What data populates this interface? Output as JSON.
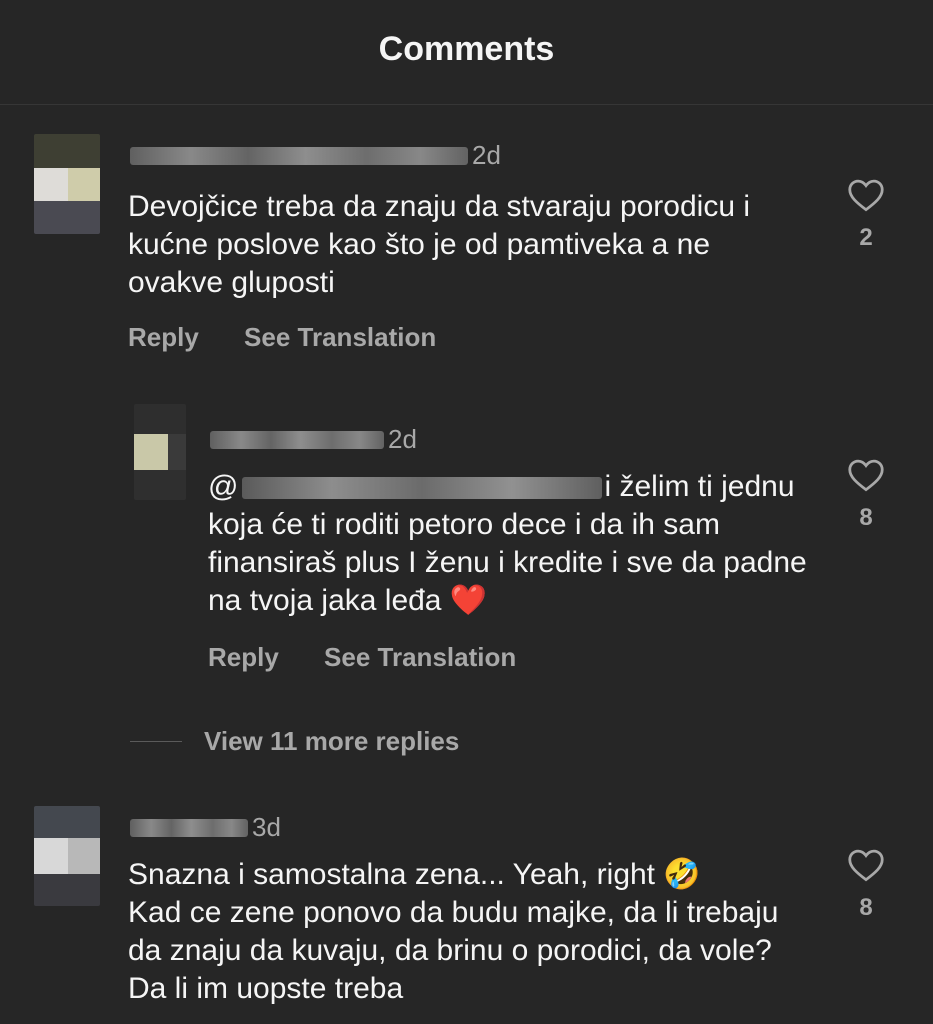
{
  "header": {
    "title": "Comments"
  },
  "comments": [
    {
      "time": "2d",
      "text": "Devojčice treba da znaju da stvaraju porodicu i kućne poslove kao što je od pamtiveka a ne ovakve gluposti",
      "reply_label": "Reply",
      "translate_label": "See Translation",
      "likes": "2"
    },
    {
      "time": "2d",
      "text_prefix": "@",
      "text": "i želim ti jednu koja će ti roditi petoro dece i da ih sam finansiraš plus I ženu i kredite i sve da padne na tvoja jaka leđa",
      "emoji": "❤️",
      "reply_label": "Reply",
      "translate_label": "See Translation",
      "likes": "8"
    },
    {
      "time": "3d",
      "text": "Snazna i samostalna zena... Yeah, right",
      "text_cont": "Kad ce zene ponovo da budu majke, da li trebaju da znaju da kuvaju, da brinu o porodici, da vole? Da li im uopste treba",
      "emoji": "🤣",
      "likes": "8"
    }
  ],
  "view_more": {
    "label": "View 11 more replies"
  },
  "icons": {
    "like": "heart-outline-icon"
  },
  "colors": {
    "background": "#262626",
    "text": "#f5f5f5",
    "muted": "#a8a8a8"
  }
}
